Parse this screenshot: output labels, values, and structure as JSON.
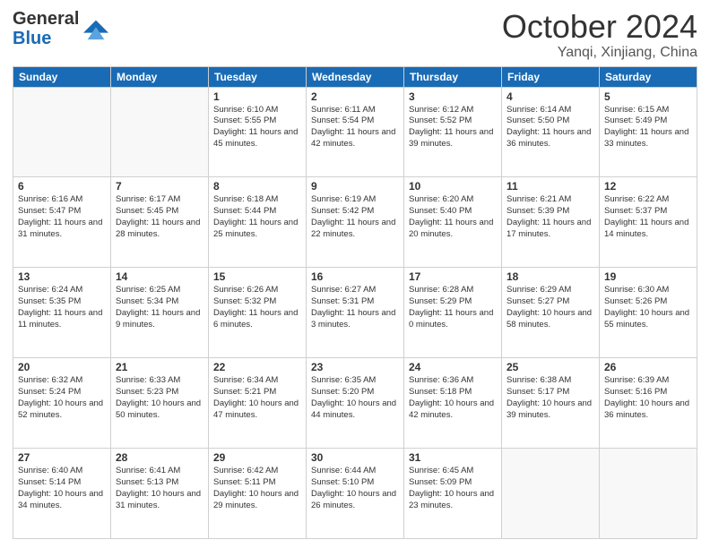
{
  "header": {
    "logo_general": "General",
    "logo_blue": "Blue",
    "month": "October 2024",
    "location": "Yanqi, Xinjiang, China"
  },
  "weekdays": [
    "Sunday",
    "Monday",
    "Tuesday",
    "Wednesday",
    "Thursday",
    "Friday",
    "Saturday"
  ],
  "weeks": [
    [
      {
        "day": "",
        "empty": true
      },
      {
        "day": "",
        "empty": true
      },
      {
        "day": "1",
        "sunrise": "Sunrise: 6:10 AM",
        "sunset": "Sunset: 5:55 PM",
        "daylight": "Daylight: 11 hours and 45 minutes."
      },
      {
        "day": "2",
        "sunrise": "Sunrise: 6:11 AM",
        "sunset": "Sunset: 5:54 PM",
        "daylight": "Daylight: 11 hours and 42 minutes."
      },
      {
        "day": "3",
        "sunrise": "Sunrise: 6:12 AM",
        "sunset": "Sunset: 5:52 PM",
        "daylight": "Daylight: 11 hours and 39 minutes."
      },
      {
        "day": "4",
        "sunrise": "Sunrise: 6:14 AM",
        "sunset": "Sunset: 5:50 PM",
        "daylight": "Daylight: 11 hours and 36 minutes."
      },
      {
        "day": "5",
        "sunrise": "Sunrise: 6:15 AM",
        "sunset": "Sunset: 5:49 PM",
        "daylight": "Daylight: 11 hours and 33 minutes."
      }
    ],
    [
      {
        "day": "6",
        "sunrise": "Sunrise: 6:16 AM",
        "sunset": "Sunset: 5:47 PM",
        "daylight": "Daylight: 11 hours and 31 minutes."
      },
      {
        "day": "7",
        "sunrise": "Sunrise: 6:17 AM",
        "sunset": "Sunset: 5:45 PM",
        "daylight": "Daylight: 11 hours and 28 minutes."
      },
      {
        "day": "8",
        "sunrise": "Sunrise: 6:18 AM",
        "sunset": "Sunset: 5:44 PM",
        "daylight": "Daylight: 11 hours and 25 minutes."
      },
      {
        "day": "9",
        "sunrise": "Sunrise: 6:19 AM",
        "sunset": "Sunset: 5:42 PM",
        "daylight": "Daylight: 11 hours and 22 minutes."
      },
      {
        "day": "10",
        "sunrise": "Sunrise: 6:20 AM",
        "sunset": "Sunset: 5:40 PM",
        "daylight": "Daylight: 11 hours and 20 minutes."
      },
      {
        "day": "11",
        "sunrise": "Sunrise: 6:21 AM",
        "sunset": "Sunset: 5:39 PM",
        "daylight": "Daylight: 11 hours and 17 minutes."
      },
      {
        "day": "12",
        "sunrise": "Sunrise: 6:22 AM",
        "sunset": "Sunset: 5:37 PM",
        "daylight": "Daylight: 11 hours and 14 minutes."
      }
    ],
    [
      {
        "day": "13",
        "sunrise": "Sunrise: 6:24 AM",
        "sunset": "Sunset: 5:35 PM",
        "daylight": "Daylight: 11 hours and 11 minutes."
      },
      {
        "day": "14",
        "sunrise": "Sunrise: 6:25 AM",
        "sunset": "Sunset: 5:34 PM",
        "daylight": "Daylight: 11 hours and 9 minutes."
      },
      {
        "day": "15",
        "sunrise": "Sunrise: 6:26 AM",
        "sunset": "Sunset: 5:32 PM",
        "daylight": "Daylight: 11 hours and 6 minutes."
      },
      {
        "day": "16",
        "sunrise": "Sunrise: 6:27 AM",
        "sunset": "Sunset: 5:31 PM",
        "daylight": "Daylight: 11 hours and 3 minutes."
      },
      {
        "day": "17",
        "sunrise": "Sunrise: 6:28 AM",
        "sunset": "Sunset: 5:29 PM",
        "daylight": "Daylight: 11 hours and 0 minutes."
      },
      {
        "day": "18",
        "sunrise": "Sunrise: 6:29 AM",
        "sunset": "Sunset: 5:27 PM",
        "daylight": "Daylight: 10 hours and 58 minutes."
      },
      {
        "day": "19",
        "sunrise": "Sunrise: 6:30 AM",
        "sunset": "Sunset: 5:26 PM",
        "daylight": "Daylight: 10 hours and 55 minutes."
      }
    ],
    [
      {
        "day": "20",
        "sunrise": "Sunrise: 6:32 AM",
        "sunset": "Sunset: 5:24 PM",
        "daylight": "Daylight: 10 hours and 52 minutes."
      },
      {
        "day": "21",
        "sunrise": "Sunrise: 6:33 AM",
        "sunset": "Sunset: 5:23 PM",
        "daylight": "Daylight: 10 hours and 50 minutes."
      },
      {
        "day": "22",
        "sunrise": "Sunrise: 6:34 AM",
        "sunset": "Sunset: 5:21 PM",
        "daylight": "Daylight: 10 hours and 47 minutes."
      },
      {
        "day": "23",
        "sunrise": "Sunrise: 6:35 AM",
        "sunset": "Sunset: 5:20 PM",
        "daylight": "Daylight: 10 hours and 44 minutes."
      },
      {
        "day": "24",
        "sunrise": "Sunrise: 6:36 AM",
        "sunset": "Sunset: 5:18 PM",
        "daylight": "Daylight: 10 hours and 42 minutes."
      },
      {
        "day": "25",
        "sunrise": "Sunrise: 6:38 AM",
        "sunset": "Sunset: 5:17 PM",
        "daylight": "Daylight: 10 hours and 39 minutes."
      },
      {
        "day": "26",
        "sunrise": "Sunrise: 6:39 AM",
        "sunset": "Sunset: 5:16 PM",
        "daylight": "Daylight: 10 hours and 36 minutes."
      }
    ],
    [
      {
        "day": "27",
        "sunrise": "Sunrise: 6:40 AM",
        "sunset": "Sunset: 5:14 PM",
        "daylight": "Daylight: 10 hours and 34 minutes."
      },
      {
        "day": "28",
        "sunrise": "Sunrise: 6:41 AM",
        "sunset": "Sunset: 5:13 PM",
        "daylight": "Daylight: 10 hours and 31 minutes."
      },
      {
        "day": "29",
        "sunrise": "Sunrise: 6:42 AM",
        "sunset": "Sunset: 5:11 PM",
        "daylight": "Daylight: 10 hours and 29 minutes."
      },
      {
        "day": "30",
        "sunrise": "Sunrise: 6:44 AM",
        "sunset": "Sunset: 5:10 PM",
        "daylight": "Daylight: 10 hours and 26 minutes."
      },
      {
        "day": "31",
        "sunrise": "Sunrise: 6:45 AM",
        "sunset": "Sunset: 5:09 PM",
        "daylight": "Daylight: 10 hours and 23 minutes."
      },
      {
        "day": "",
        "empty": true
      },
      {
        "day": "",
        "empty": true
      }
    ]
  ]
}
